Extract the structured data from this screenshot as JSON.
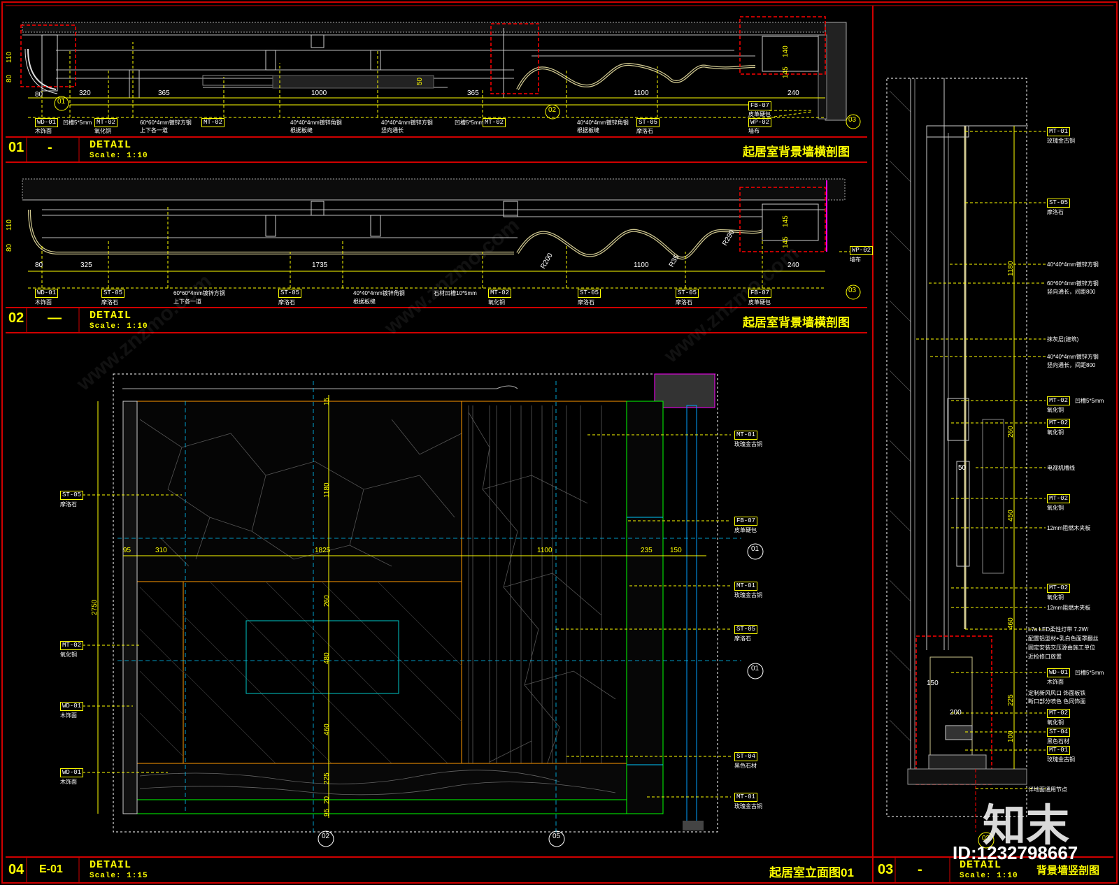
{
  "panel_01": {
    "num": "01",
    "code": "-",
    "detail": "DETAIL",
    "scale": "Scale: 1:10",
    "title": "起居室背景墙横剖图",
    "dims": [
      "320",
      "365",
      "1000",
      "365",
      "1100",
      "240",
      "80",
      "80",
      "110",
      "140",
      "145",
      "50"
    ],
    "tags": [
      "WD-01",
      "MT-02",
      "MT-02",
      "ST-05",
      "FB-07",
      "WP-02"
    ],
    "notes": [
      "木饰面",
      "凹槽5*5mm",
      "氧化铜",
      "60*60*4mm镀锌方钢",
      "上下各一道",
      "40*40*4mm镀锌角钢",
      "根据板缝",
      "40*40*4mm镀锌方钢",
      "竖向通长",
      "凹槽5*5mm",
      "40*40*4mm镀锌角钢",
      "根据板缝",
      "摩洛石",
      "皮革硬包",
      "墙布"
    ],
    "callouts": [
      "01",
      "02",
      "03"
    ]
  },
  "panel_02": {
    "num": "02",
    "code": "—",
    "detail": "DETAIL",
    "scale": "Scale: 1:10",
    "title": "起居室背景墙横剖图",
    "dims": [
      "80",
      "325",
      "1735",
      "1100",
      "240",
      "110",
      "80",
      "145",
      "145",
      "R200",
      "R35",
      "R290"
    ],
    "tags": [
      "WD-01",
      "ST-05",
      "ST-05",
      "MT-02",
      "ST-05",
      "ST-05",
      "FB-07",
      "WP-02"
    ],
    "notes": [
      "木饰面",
      "摩洛石",
      "60*60*4mm镀锌方钢",
      "上下各一道",
      "摩洛石",
      "40*40*4mm镀锌角钢",
      "根据板缝",
      "石材凹槽10*5mm",
      "氧化铜",
      "摩洛石",
      "摩洛石",
      "皮革硬包",
      "墙布"
    ],
    "callouts": [
      "03"
    ]
  },
  "panel_04": {
    "num": "04",
    "code": "E-01",
    "detail": "DETAIL",
    "scale": "Scale: 1:15",
    "title": "起居室立面图01",
    "dims_h": [
      "95",
      "310",
      "1825",
      "1100",
      "235",
      "150"
    ],
    "dims_v": [
      "15",
      "1180",
      "2750",
      "260",
      "480",
      "460",
      "225",
      "20",
      "95"
    ],
    "tags_left": [
      "ST-05",
      "MT-02",
      "WD-01",
      "WD-01"
    ],
    "notes_left": [
      "摩洛石",
      "氧化铜",
      "木饰面",
      "木饰面"
    ],
    "tags_right": [
      "MT-01",
      "FB-07",
      "MT-01",
      "ST-05",
      "ST-04",
      "MT-01"
    ],
    "notes_right": [
      "玫瑰金古铜",
      "皮革硬包",
      "玫瑰金古铜",
      "摩洛石",
      "黑色石材",
      "玫瑰金古铜"
    ],
    "callouts": [
      "01",
      "01",
      "02",
      "05"
    ]
  },
  "panel_03": {
    "num": "03",
    "code": "-",
    "detail": "DETAIL",
    "scale": "Scale: 1:10",
    "title": "背景墙竖剖图",
    "dims_v": [
      "1180",
      "260",
      "450",
      "460",
      "225",
      "100"
    ],
    "dims_h": [
      "50",
      "150",
      "200"
    ],
    "tags": [
      "MT-01",
      "ST-05",
      "MT-02",
      "MT-02",
      "MT-02",
      "MT-02",
      "WD-01",
      "MT-02",
      "ST-04",
      "MT-01"
    ],
    "notes": [
      "玫瑰金古铜",
      "摩洛石",
      "40*40*4mm镀锌方钢",
      "60*60*4mm镀锌方钢",
      "竖向通长，间距800",
      "抹灰层(建筑)",
      "40*40*4mm镀锌方钢",
      "竖向通长，间距800",
      "凹槽5*5mm",
      "氧化铜",
      "氧化铜",
      "电视机槽线",
      "氧化铜",
      "12mm阻燃木夹板",
      "氧化铜",
      "12mm阻燃木夹板",
      "L7a LED柔性灯带 7.2W/",
      "配置铝型材+乳白色面罩翻丝",
      "固定安装交压源由施工单位",
      "近检修口放置",
      "凹槽5*5mm",
      "木饰面",
      "定制新风风口 饰面板铁",
      "断口部分喷色 色同饰面",
      "氧化铜",
      "黑色石材",
      "玫瑰金古铜",
      "详地面通用节点"
    ],
    "callouts": [
      "03"
    ]
  },
  "watermark": {
    "logo": "知末",
    "id": "ID:1232798667",
    "site": "www.znzmo.com"
  },
  "colors": {
    "frame": "#d00000",
    "annotation": "#ffff00",
    "hidden": "#ff0000",
    "grid": "#00c8ff",
    "panel": "#ff9900",
    "green": "#00ff00"
  }
}
